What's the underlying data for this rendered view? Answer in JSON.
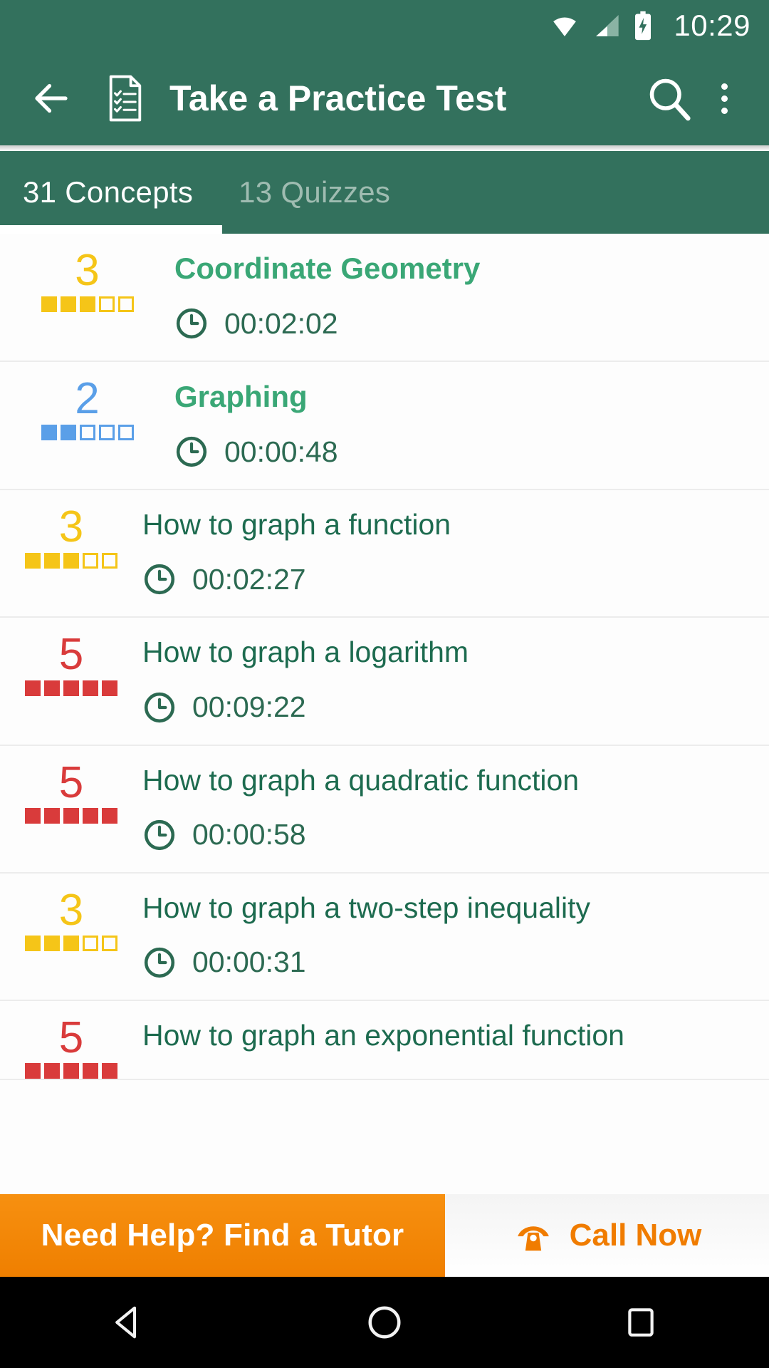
{
  "status_bar": {
    "time": "10:29",
    "icons": [
      "wifi-icon",
      "signal-icon",
      "battery-charging-icon"
    ]
  },
  "app_bar": {
    "back_icon": "back-arrow-icon",
    "doc_icon": "practice-test-icon",
    "title": "Take a Practice Test",
    "search_icon": "search-icon",
    "more_icon": "overflow-menu-icon"
  },
  "tabs": [
    {
      "label": "31 Concepts",
      "active": true
    },
    {
      "label": "13 Quizzes",
      "active": false
    }
  ],
  "colors": {
    "brand_green": "#33715d",
    "title_green_bold": "#3aa776",
    "title_green": "#1d6b4f",
    "time_green": "#2c6a52",
    "score_yellow": "#f5c518",
    "score_blue": "#5a9fe8",
    "score_red": "#d93b3b",
    "banner_orange": "#ef7f00",
    "divider": "#ececec"
  },
  "list": [
    {
      "score": "3",
      "score_color": "#f5c518",
      "filled": 3,
      "total": 5,
      "title": "Coordinate Geometry",
      "bold": true,
      "indent": true,
      "time": "00:02:02",
      "clock_icon": "clock-icon"
    },
    {
      "score": "2",
      "score_color": "#5a9fe8",
      "filled": 2,
      "total": 5,
      "title": "Graphing",
      "bold": true,
      "indent": true,
      "time": "00:00:48",
      "clock_icon": "clock-icon"
    },
    {
      "score": "3",
      "score_color": "#f5c518",
      "filled": 3,
      "total": 5,
      "title": "How to graph a function",
      "bold": false,
      "indent": false,
      "time": "00:02:27",
      "clock_icon": "clock-icon"
    },
    {
      "score": "5",
      "score_color": "#d93b3b",
      "filled": 5,
      "total": 5,
      "title": "How to graph a logarithm",
      "bold": false,
      "indent": false,
      "time": "00:09:22",
      "clock_icon": "clock-icon"
    },
    {
      "score": "5",
      "score_color": "#d93b3b",
      "filled": 5,
      "total": 5,
      "title": "How to graph a quadratic function",
      "bold": false,
      "indent": false,
      "time": "00:00:58",
      "clock_icon": "clock-icon"
    },
    {
      "score": "3",
      "score_color": "#f5c518",
      "filled": 3,
      "total": 5,
      "title": "How to graph a two-step inequality",
      "bold": false,
      "indent": false,
      "time": "00:00:31",
      "clock_icon": "clock-icon"
    },
    {
      "score": "5",
      "score_color": "#d93b3b",
      "filled": 5,
      "total": 5,
      "title": "How to graph an exponential function",
      "bold": false,
      "indent": false,
      "time": "",
      "clock_icon": "clock-icon"
    }
  ],
  "banner": {
    "main_label": "Need Help? Find a Tutor",
    "call_label": "Call Now",
    "phone_icon": "phone-icon"
  },
  "nav_bar": {
    "back": "nav-back-icon",
    "home": "nav-home-icon",
    "recents": "nav-recents-icon"
  }
}
